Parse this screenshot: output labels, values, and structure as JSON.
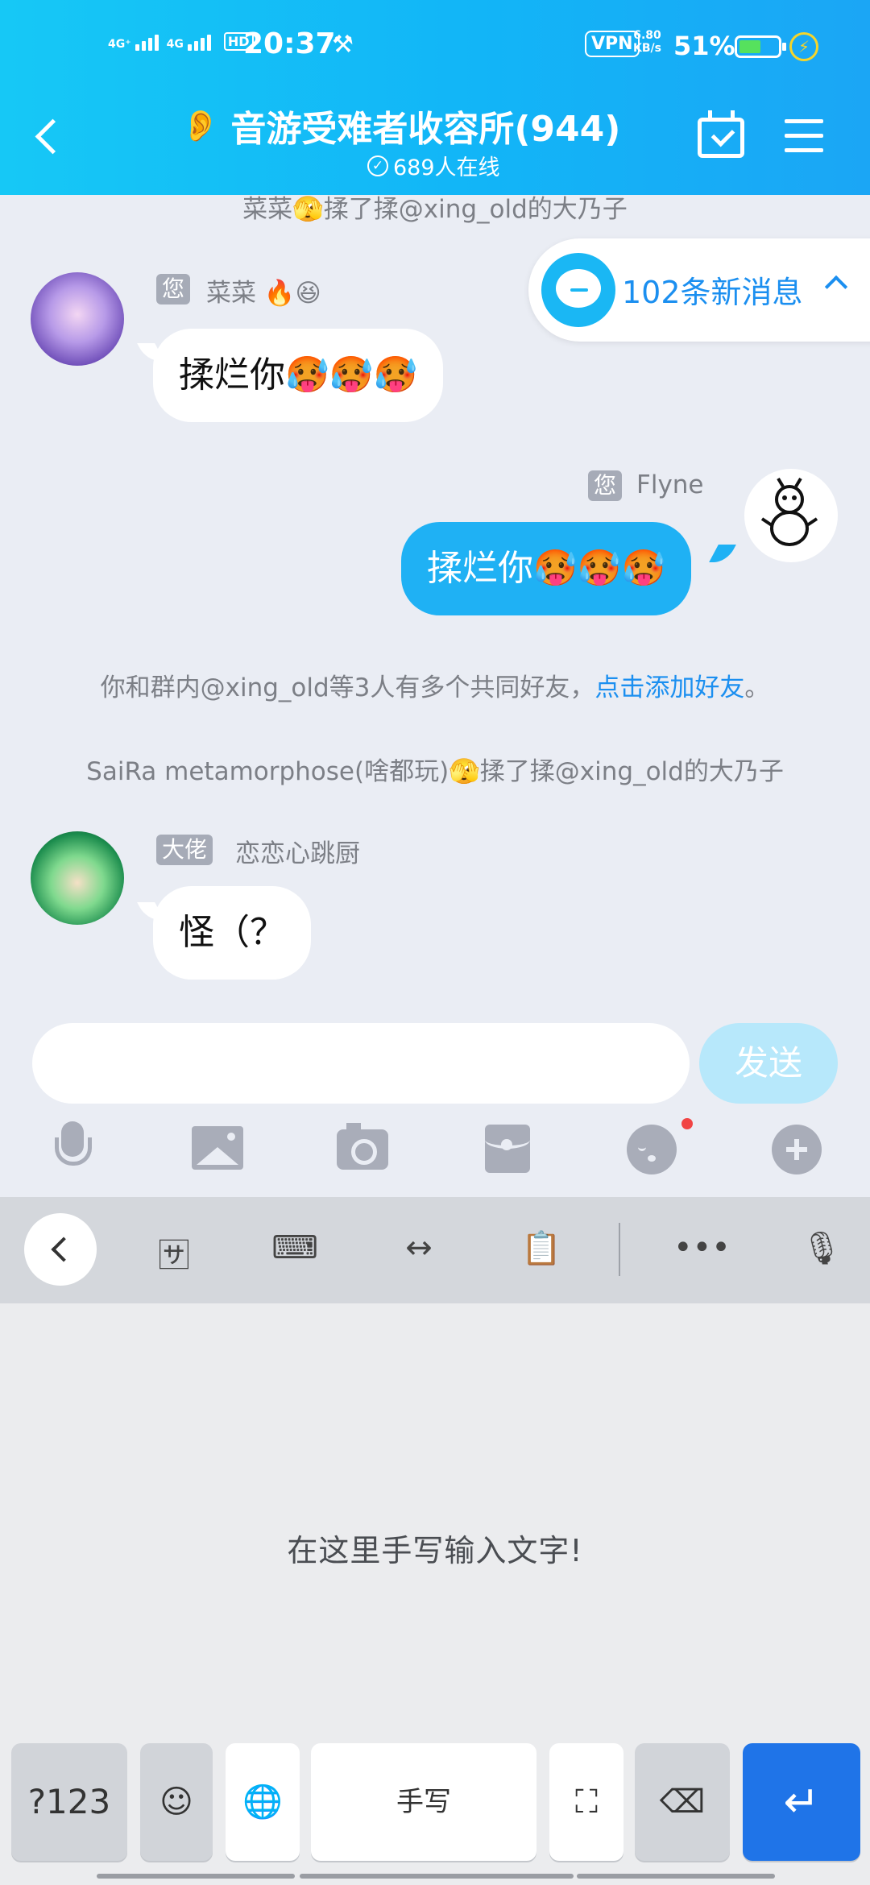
{
  "status_bar": {
    "net1": "4G⁺",
    "net2": "4G",
    "hd": "HD",
    "time": "20:37",
    "vpn": "VPN",
    "speed_value": "6.80",
    "speed_unit": "KB/s",
    "battery_text": "51%",
    "battery_level": 0.51
  },
  "header": {
    "title": "音游受难者收容所(944)",
    "online": "689人在线"
  },
  "notifications": {
    "new_messages": "102条新消息"
  },
  "messages": {
    "sys_top": "菜菜🫣揉了揉@xing_old的大乃子",
    "m1": {
      "tag": "您",
      "nick": "菜菜 🔥😆",
      "text": "揉烂你🥵🥵🥵"
    },
    "m2": {
      "tag": "您",
      "nick": "Flyne",
      "text": "揉烂你🥵🥵🥵"
    },
    "sys_friend_prefix": "你和群内@xing_old等3人有多个共同好友，",
    "sys_friend_link": "点击添加好友",
    "sys_friend_suffix": "。",
    "sys_poke": "SaiRa metamorphose(啥都玩)🫣揉了揉@xing_old的大乃子",
    "m3": {
      "tag": "大佬",
      "nick": "恋恋心跳厨",
      "text": "怪（？"
    }
  },
  "composer": {
    "send": "发送",
    "placeholder": ""
  },
  "keyboard": {
    "hint": "在这里手写输入文字!",
    "key_num": "?123",
    "key_space": "手写"
  },
  "colors": {
    "header_blue": "#16c8f6",
    "bubble_blue": "#1fb1f4",
    "link_blue": "#1b8ff0",
    "enter_blue": "#1f74e8"
  }
}
